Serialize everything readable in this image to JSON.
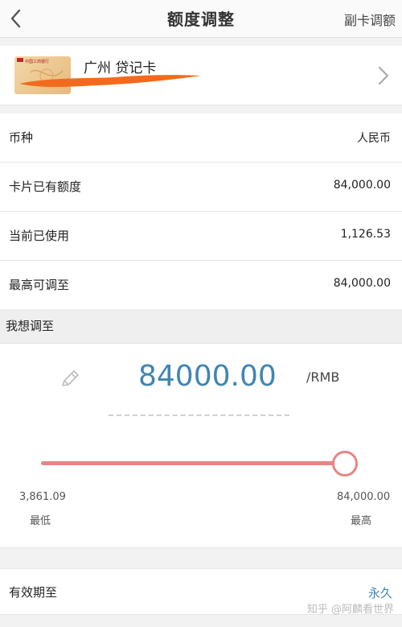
{
  "header": {
    "title": "额度调整",
    "right_action": "副卡调额"
  },
  "card": {
    "name": "广州 贷记卡",
    "bank_logo_text": "中国工商银行"
  },
  "info_rows": [
    {
      "label": "币种",
      "value": "人民币"
    },
    {
      "label": "卡片已有额度",
      "value": "84,000.00"
    },
    {
      "label": "当前已使用",
      "value": "1,126.53"
    },
    {
      "label": "最高可调至",
      "value": "84,000.00"
    }
  ],
  "adjust": {
    "section_title": "我想调至",
    "amount": "84000.00",
    "unit": "/RMB",
    "slider": {
      "min_value": "3,861.09",
      "min_label": "最低",
      "max_value": "84,000.00",
      "max_label": "最高",
      "position_fraction": 1.0
    }
  },
  "expiry": {
    "label": "有效期至",
    "value": "永久"
  },
  "watermark": "知乎 @阿麟看世界",
  "colors": {
    "accent_blue": "#3f86b3",
    "slider_red": "#e78585",
    "redaction_orange": "#f26b1d"
  }
}
